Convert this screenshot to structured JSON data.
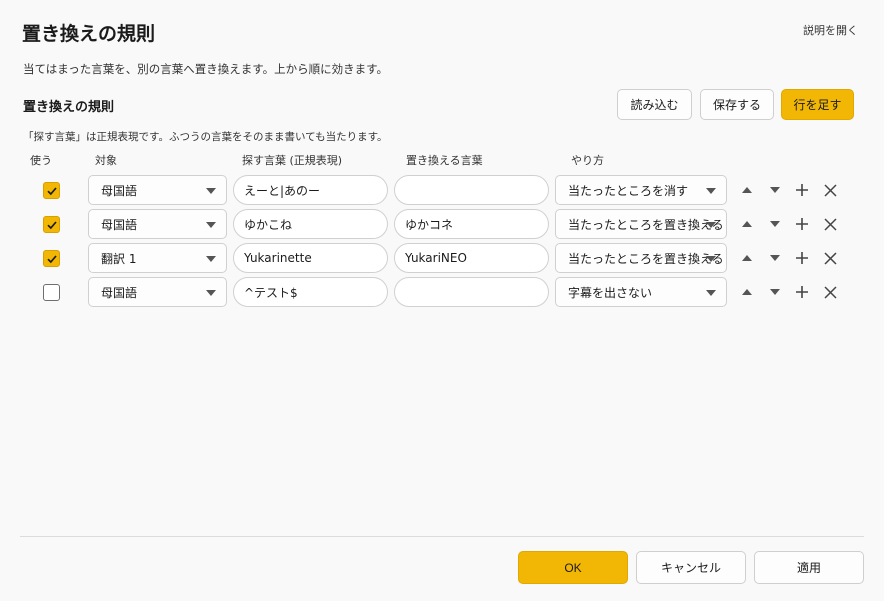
{
  "dialog": {
    "title": "置き換えの規則",
    "help_link": "説明を開く",
    "description": "当てはまった言葉を、別の言葉へ置き換えます。上から順に効きます。"
  },
  "rules_section": {
    "title": "置き換えの規則",
    "load_button": "読み込む",
    "save_button": "保存する",
    "add_row_button": "行を足す",
    "hint": "「探す言葉」は正規表現です。ふつうの言葉をそのまま書いても当たります。"
  },
  "columns": {
    "use": "使う",
    "target": "対象",
    "find": "探す言葉 (正規表現)",
    "replace": "置き換える言葉",
    "method": "やり方"
  },
  "rows": [
    {
      "enabled": true,
      "target": "母国語",
      "find": "えーと|あのー",
      "replace": "",
      "method": "当たったところを消す"
    },
    {
      "enabled": true,
      "target": "母国語",
      "find": "ゆかこね",
      "replace": "ゆかコネ",
      "method": "当たったところを置き換える"
    },
    {
      "enabled": true,
      "target": "翻訳 1",
      "find": "Yukarinette",
      "replace": "YukariNEO",
      "method": "当たったところを置き換える"
    },
    {
      "enabled": false,
      "target": "母国語",
      "find": "^テスト$",
      "replace": "",
      "method": "字幕を出さない"
    }
  ],
  "footer": {
    "ok_button": "OK",
    "cancel_button": "キャンセル",
    "apply_button": "適用"
  },
  "colors": {
    "accent": "#f2b705",
    "background": "#f9f9f9"
  },
  "icons": {
    "move_up": "triangle-up-icon",
    "move_down": "triangle-down-icon",
    "add": "plus-icon",
    "delete": "close-icon",
    "check": "checkmark-icon",
    "dropdown": "chevron-down-icon"
  }
}
